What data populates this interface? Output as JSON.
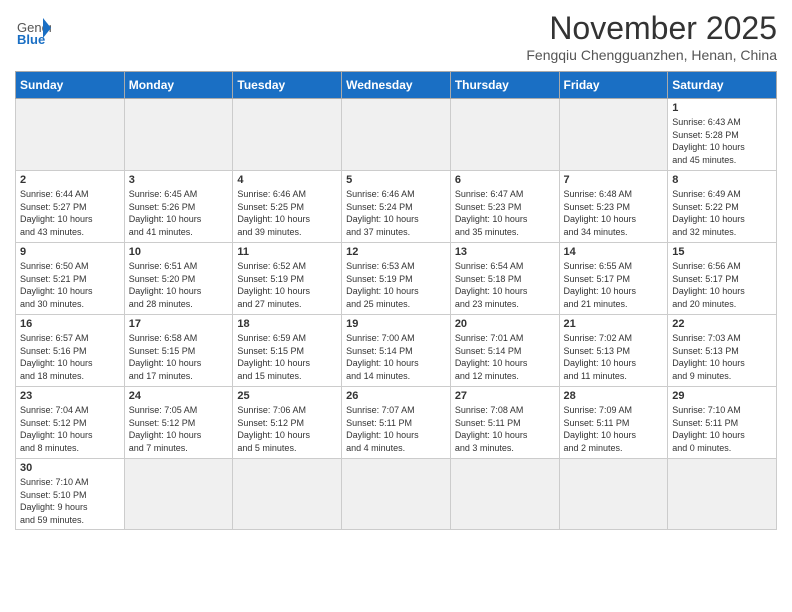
{
  "header": {
    "logo_general": "General",
    "logo_blue": "Blue",
    "title": "November 2025",
    "location": "Fengqiu Chengguanzhen, Henan, China"
  },
  "days_of_week": [
    "Sunday",
    "Monday",
    "Tuesday",
    "Wednesday",
    "Thursday",
    "Friday",
    "Saturday"
  ],
  "weeks": [
    [
      {
        "day": "",
        "info": ""
      },
      {
        "day": "",
        "info": ""
      },
      {
        "day": "",
        "info": ""
      },
      {
        "day": "",
        "info": ""
      },
      {
        "day": "",
        "info": ""
      },
      {
        "day": "",
        "info": ""
      },
      {
        "day": "1",
        "info": "Sunrise: 6:43 AM\nSunset: 5:28 PM\nDaylight: 10 hours\nand 45 minutes."
      }
    ],
    [
      {
        "day": "2",
        "info": "Sunrise: 6:44 AM\nSunset: 5:27 PM\nDaylight: 10 hours\nand 43 minutes."
      },
      {
        "day": "3",
        "info": "Sunrise: 6:45 AM\nSunset: 5:26 PM\nDaylight: 10 hours\nand 41 minutes."
      },
      {
        "day": "4",
        "info": "Sunrise: 6:46 AM\nSunset: 5:25 PM\nDaylight: 10 hours\nand 39 minutes."
      },
      {
        "day": "5",
        "info": "Sunrise: 6:46 AM\nSunset: 5:24 PM\nDaylight: 10 hours\nand 37 minutes."
      },
      {
        "day": "6",
        "info": "Sunrise: 6:47 AM\nSunset: 5:23 PM\nDaylight: 10 hours\nand 35 minutes."
      },
      {
        "day": "7",
        "info": "Sunrise: 6:48 AM\nSunset: 5:23 PM\nDaylight: 10 hours\nand 34 minutes."
      },
      {
        "day": "8",
        "info": "Sunrise: 6:49 AM\nSunset: 5:22 PM\nDaylight: 10 hours\nand 32 minutes."
      }
    ],
    [
      {
        "day": "9",
        "info": "Sunrise: 6:50 AM\nSunset: 5:21 PM\nDaylight: 10 hours\nand 30 minutes."
      },
      {
        "day": "10",
        "info": "Sunrise: 6:51 AM\nSunset: 5:20 PM\nDaylight: 10 hours\nand 28 minutes."
      },
      {
        "day": "11",
        "info": "Sunrise: 6:52 AM\nSunset: 5:19 PM\nDaylight: 10 hours\nand 27 minutes."
      },
      {
        "day": "12",
        "info": "Sunrise: 6:53 AM\nSunset: 5:19 PM\nDaylight: 10 hours\nand 25 minutes."
      },
      {
        "day": "13",
        "info": "Sunrise: 6:54 AM\nSunset: 5:18 PM\nDaylight: 10 hours\nand 23 minutes."
      },
      {
        "day": "14",
        "info": "Sunrise: 6:55 AM\nSunset: 5:17 PM\nDaylight: 10 hours\nand 21 minutes."
      },
      {
        "day": "15",
        "info": "Sunrise: 6:56 AM\nSunset: 5:17 PM\nDaylight: 10 hours\nand 20 minutes."
      }
    ],
    [
      {
        "day": "16",
        "info": "Sunrise: 6:57 AM\nSunset: 5:16 PM\nDaylight: 10 hours\nand 18 minutes."
      },
      {
        "day": "17",
        "info": "Sunrise: 6:58 AM\nSunset: 5:15 PM\nDaylight: 10 hours\nand 17 minutes."
      },
      {
        "day": "18",
        "info": "Sunrise: 6:59 AM\nSunset: 5:15 PM\nDaylight: 10 hours\nand 15 minutes."
      },
      {
        "day": "19",
        "info": "Sunrise: 7:00 AM\nSunset: 5:14 PM\nDaylight: 10 hours\nand 14 minutes."
      },
      {
        "day": "20",
        "info": "Sunrise: 7:01 AM\nSunset: 5:14 PM\nDaylight: 10 hours\nand 12 minutes."
      },
      {
        "day": "21",
        "info": "Sunrise: 7:02 AM\nSunset: 5:13 PM\nDaylight: 10 hours\nand 11 minutes."
      },
      {
        "day": "22",
        "info": "Sunrise: 7:03 AM\nSunset: 5:13 PM\nDaylight: 10 hours\nand 9 minutes."
      }
    ],
    [
      {
        "day": "23",
        "info": "Sunrise: 7:04 AM\nSunset: 5:12 PM\nDaylight: 10 hours\nand 8 minutes."
      },
      {
        "day": "24",
        "info": "Sunrise: 7:05 AM\nSunset: 5:12 PM\nDaylight: 10 hours\nand 7 minutes."
      },
      {
        "day": "25",
        "info": "Sunrise: 7:06 AM\nSunset: 5:12 PM\nDaylight: 10 hours\nand 5 minutes."
      },
      {
        "day": "26",
        "info": "Sunrise: 7:07 AM\nSunset: 5:11 PM\nDaylight: 10 hours\nand 4 minutes."
      },
      {
        "day": "27",
        "info": "Sunrise: 7:08 AM\nSunset: 5:11 PM\nDaylight: 10 hours\nand 3 minutes."
      },
      {
        "day": "28",
        "info": "Sunrise: 7:09 AM\nSunset: 5:11 PM\nDaylight: 10 hours\nand 2 minutes."
      },
      {
        "day": "29",
        "info": "Sunrise: 7:10 AM\nSunset: 5:11 PM\nDaylight: 10 hours\nand 0 minutes."
      }
    ],
    [
      {
        "day": "30",
        "info": "Sunrise: 7:10 AM\nSunset: 5:10 PM\nDaylight: 9 hours\nand 59 minutes."
      },
      {
        "day": "",
        "info": ""
      },
      {
        "day": "",
        "info": ""
      },
      {
        "day": "",
        "info": ""
      },
      {
        "day": "",
        "info": ""
      },
      {
        "day": "",
        "info": ""
      },
      {
        "day": "",
        "info": ""
      }
    ]
  ]
}
